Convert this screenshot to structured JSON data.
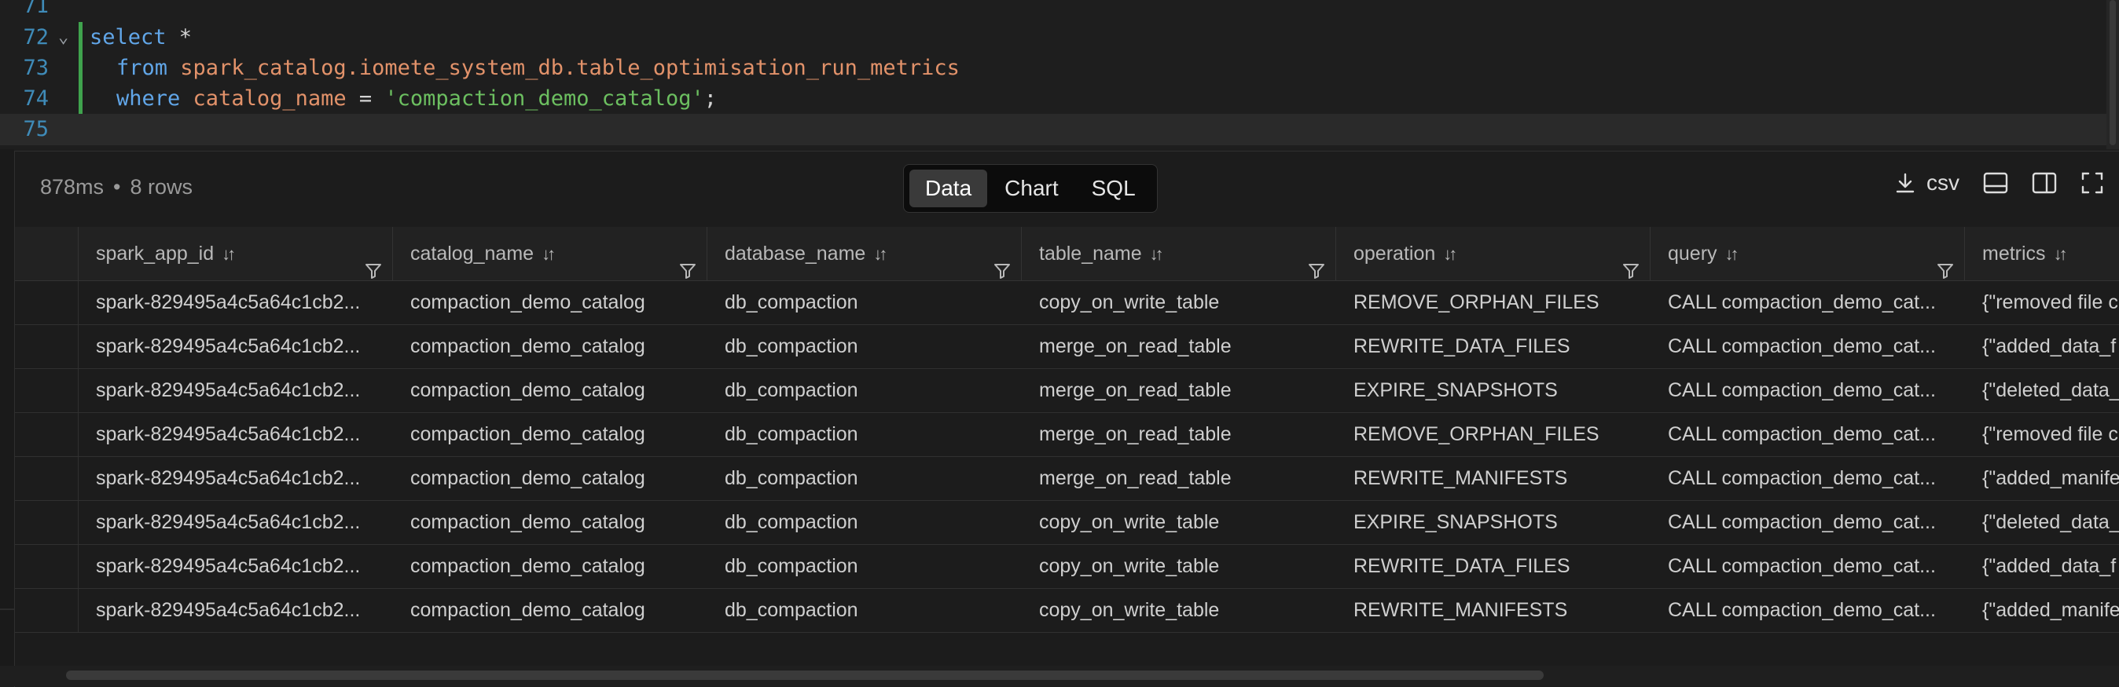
{
  "editor": {
    "lines": [
      {
        "num": "71"
      },
      {
        "num": "72",
        "t1": "select",
        "t2": " *"
      },
      {
        "num": "73",
        "t1": "from",
        "t2": "spark_catalog.iomete_system_db.table_optimisation_run_metrics"
      },
      {
        "num": "74",
        "t1": "where",
        "t2": "catalog_name",
        "t3": " = ",
        "t4": "'compaction_demo_catalog'",
        "t5": ";"
      },
      {
        "num": "75"
      }
    ]
  },
  "results": {
    "duration": "878ms",
    "separator": "•",
    "rows_count": "8 rows",
    "tabs": [
      "Data",
      "Chart",
      "SQL"
    ],
    "active_tab": "Data",
    "download_label": "csv",
    "columns": [
      "spark_app_id",
      "catalog_name",
      "database_name",
      "table_name",
      "operation",
      "query",
      "metrics"
    ],
    "rows": [
      [
        "spark-829495a4c5a64c1cb2...",
        "compaction_demo_catalog",
        "db_compaction",
        "copy_on_write_table",
        "REMOVE_ORPHAN_FILES",
        "CALL compaction_demo_cat...",
        "{\"removed file c"
      ],
      [
        "spark-829495a4c5a64c1cb2...",
        "compaction_demo_catalog",
        "db_compaction",
        "merge_on_read_table",
        "REWRITE_DATA_FILES",
        "CALL compaction_demo_cat...",
        "{\"added_data_f"
      ],
      [
        "spark-829495a4c5a64c1cb2...",
        "compaction_demo_catalog",
        "db_compaction",
        "merge_on_read_table",
        "EXPIRE_SNAPSHOTS",
        "CALL compaction_demo_cat...",
        "{\"deleted_data_"
      ],
      [
        "spark-829495a4c5a64c1cb2...",
        "compaction_demo_catalog",
        "db_compaction",
        "merge_on_read_table",
        "REMOVE_ORPHAN_FILES",
        "CALL compaction_demo_cat...",
        "{\"removed file c"
      ],
      [
        "spark-829495a4c5a64c1cb2...",
        "compaction_demo_catalog",
        "db_compaction",
        "merge_on_read_table",
        "REWRITE_MANIFESTS",
        "CALL compaction_demo_cat...",
        "{\"added_manife"
      ],
      [
        "spark-829495a4c5a64c1cb2...",
        "compaction_demo_catalog",
        "db_compaction",
        "copy_on_write_table",
        "EXPIRE_SNAPSHOTS",
        "CALL compaction_demo_cat...",
        "{\"deleted_data_"
      ],
      [
        "spark-829495a4c5a64c1cb2...",
        "compaction_demo_catalog",
        "db_compaction",
        "copy_on_write_table",
        "REWRITE_DATA_FILES",
        "CALL compaction_demo_cat...",
        "{\"added_data_f"
      ],
      [
        "spark-829495a4c5a64c1cb2...",
        "compaction_demo_catalog",
        "db_compaction",
        "copy_on_write_table",
        "REWRITE_MANIFESTS",
        "CALL compaction_demo_cat...",
        "{\"added_manife"
      ]
    ]
  }
}
